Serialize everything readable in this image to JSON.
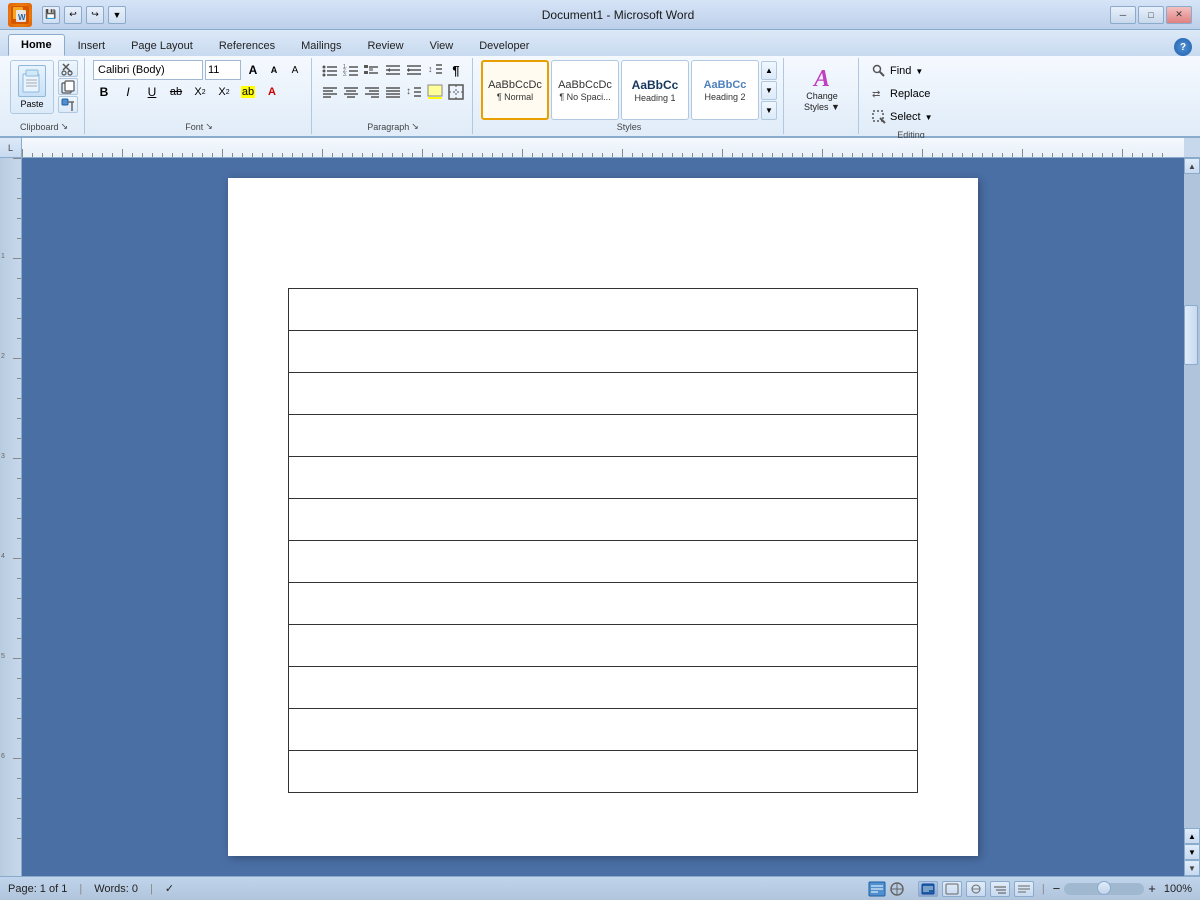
{
  "titlebar": {
    "app_name": "Document1 - Microsoft Word",
    "logo": "W",
    "minimize": "─",
    "restore": "□",
    "close": "✕",
    "save_icon": "💾",
    "undo_icon": "↩",
    "redo_icon": "↪",
    "dropdown_icon": "▼"
  },
  "tabs": [
    {
      "label": "Home",
      "active": true
    },
    {
      "label": "Insert",
      "active": false
    },
    {
      "label": "Page Layout",
      "active": false
    },
    {
      "label": "References",
      "active": false
    },
    {
      "label": "Mailings",
      "active": false
    },
    {
      "label": "Review",
      "active": false
    },
    {
      "label": "View",
      "active": false
    },
    {
      "label": "Developer",
      "active": false
    }
  ],
  "ribbon": {
    "clipboard": {
      "label": "Clipboard",
      "paste_label": "Paste",
      "cut_label": "Cut",
      "copy_label": "Copy",
      "format_painter_label": "Format Painter",
      "expand_icon": "↘"
    },
    "font": {
      "label": "Font",
      "font_name": "Calibri (Body)",
      "font_size": "11",
      "grow_icon": "A",
      "shrink_icon": "A",
      "clear_icon": "A",
      "bold": "B",
      "italic": "I",
      "underline": "U",
      "strikethrough": "ab̶c",
      "subscript": "X₂",
      "superscript": "X²",
      "text_color_label": "A",
      "highlight_label": "ab",
      "expand_icon": "↘"
    },
    "paragraph": {
      "label": "Paragraph",
      "bullet_list": "≡",
      "numbered_list": "≡",
      "multilevel_list": "≡",
      "decrease_indent": "⇤",
      "increase_indent": "⇥",
      "sort": "↕",
      "show_marks": "¶",
      "align_left": "≡",
      "align_center": "≡",
      "align_right": "≡",
      "justify": "≡",
      "line_spacing": "↕",
      "shading": "▓",
      "borders": "⊞",
      "expand_icon": "↘"
    },
    "styles": {
      "label": "Styles",
      "items": [
        {
          "name": "Normal",
          "preview": "AaBbCcDc",
          "label": "¶ Normal",
          "active": true
        },
        {
          "name": "No Spacing",
          "preview": "AaBbCcDc",
          "label": "¶ No Spaci...",
          "active": false
        },
        {
          "name": "Heading 1",
          "preview": "AaBbCc",
          "label": "Heading 1",
          "active": false
        },
        {
          "name": "Heading 2",
          "preview": "AaBbCc",
          "label": "Heading 2",
          "active": false
        }
      ],
      "scroll_up": "▲",
      "scroll_down": "▼",
      "more": "▼"
    },
    "change_styles": {
      "label": "Change\nStyles",
      "icon": "A"
    },
    "editing": {
      "label": "Editing",
      "find_label": "Find",
      "replace_label": "Replace",
      "select_label": "Select",
      "find_dropdown": "▼",
      "select_dropdown": "▼"
    }
  },
  "ruler": {
    "corner_symbol": "L"
  },
  "document": {
    "table_rows": 12,
    "table_cols": 1
  },
  "statusbar": {
    "page_info": "Page: 1 of 1",
    "words": "Words: 0",
    "check_icon": "✓",
    "view_icons": [
      "📄",
      "🖼",
      "📊",
      "📝",
      "🌐"
    ],
    "zoom_level": "100%",
    "zoom_minus": "−",
    "zoom_plus": "+"
  }
}
